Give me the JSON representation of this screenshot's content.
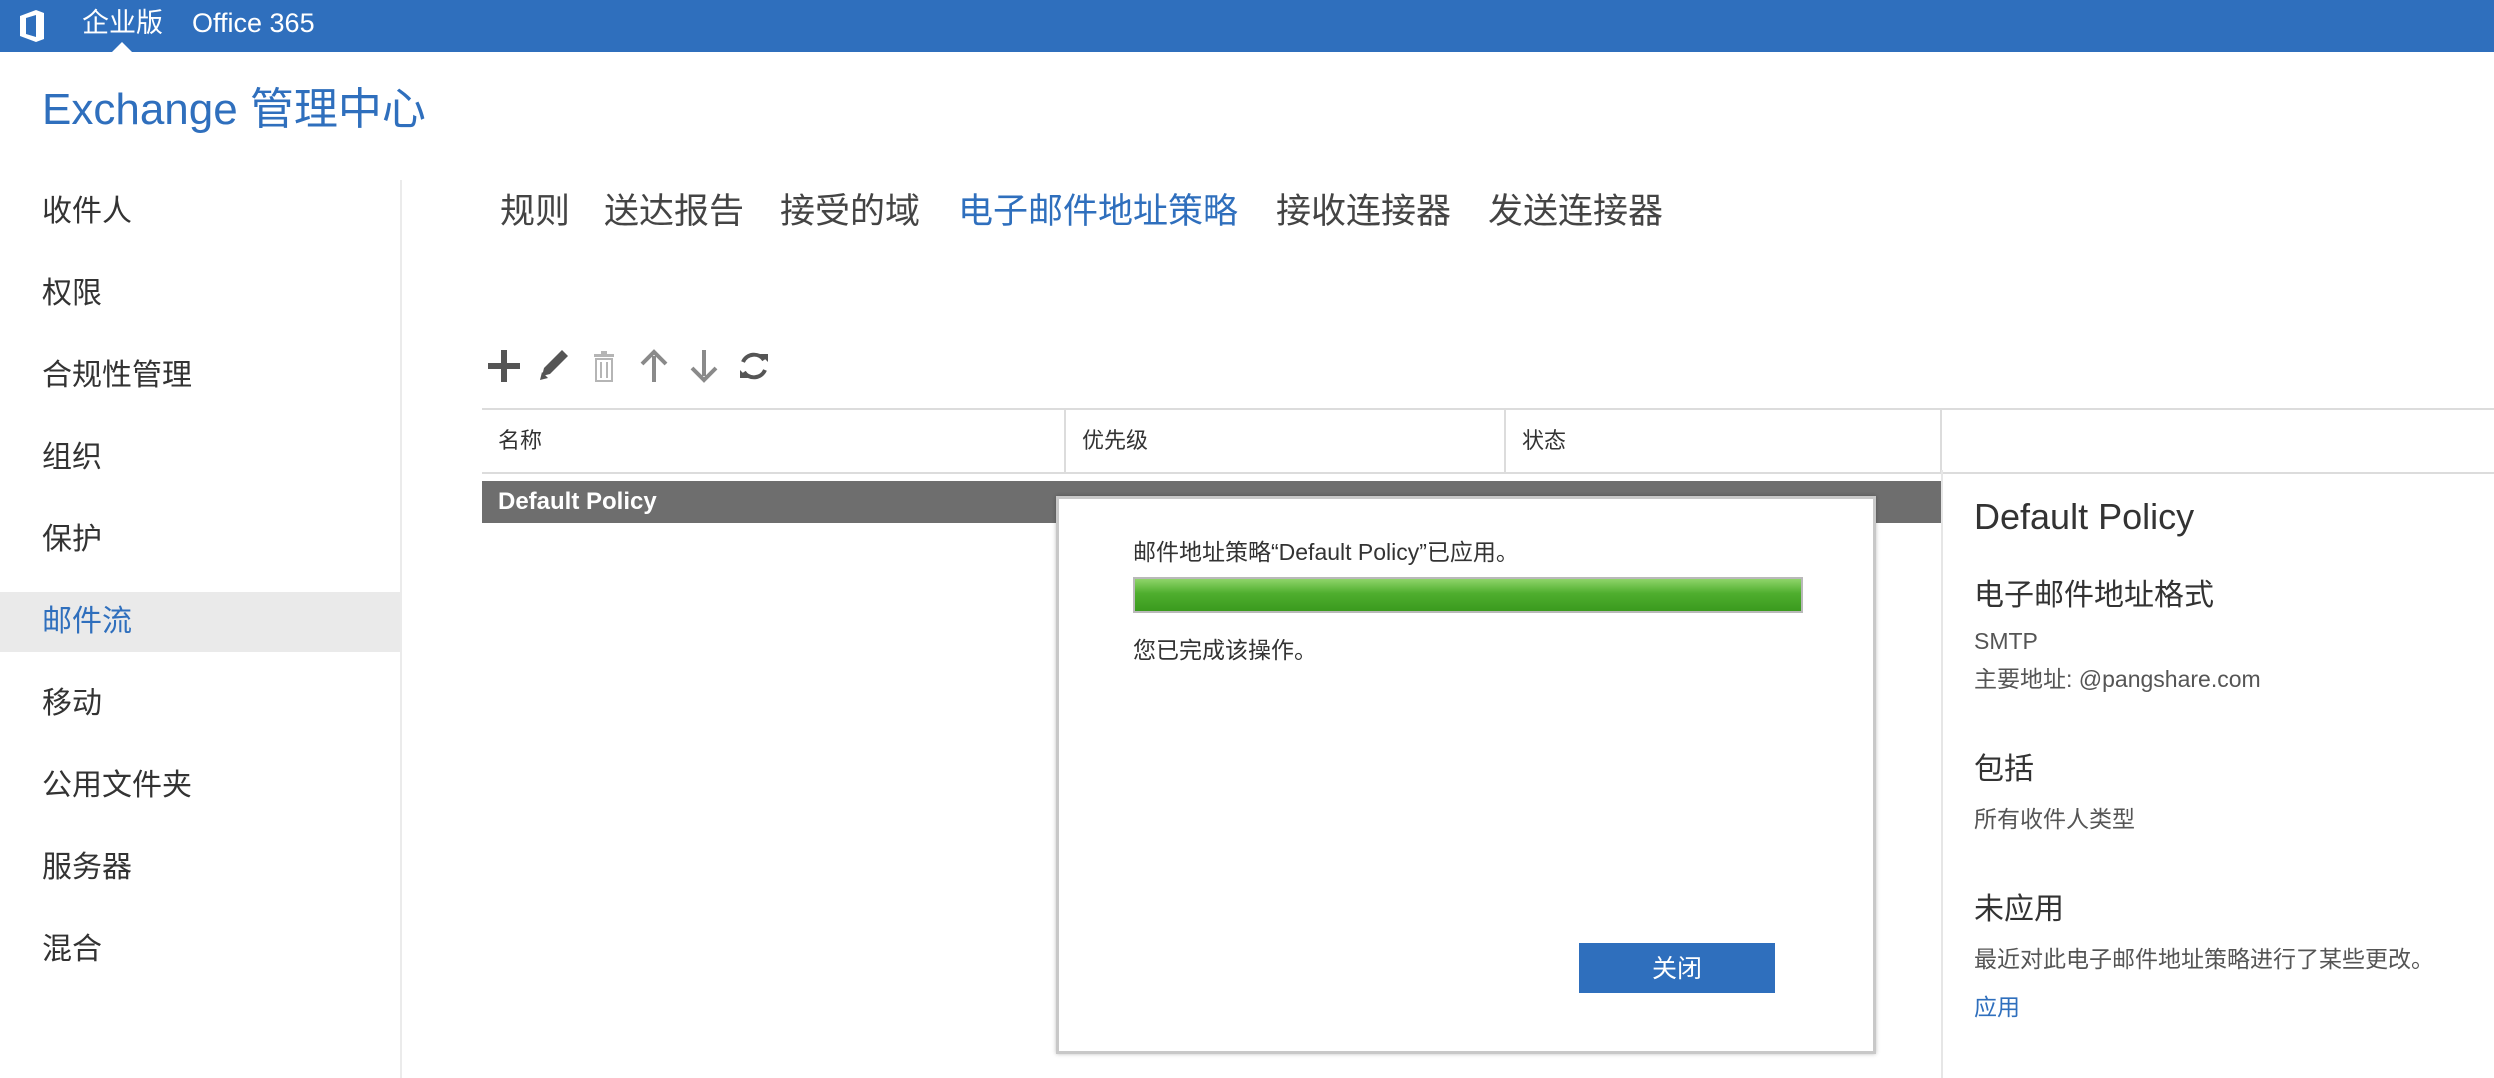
{
  "topbar": {
    "edition": "企业版",
    "product": "Office 365"
  },
  "app": {
    "title": "Exchange 管理中心"
  },
  "sidebar": {
    "items": [
      {
        "label": "收件人"
      },
      {
        "label": "权限"
      },
      {
        "label": "合规性管理"
      },
      {
        "label": "组织"
      },
      {
        "label": "保护"
      },
      {
        "label": "邮件流"
      },
      {
        "label": "移动"
      },
      {
        "label": "公用文件夹"
      },
      {
        "label": "服务器"
      },
      {
        "label": "混合"
      }
    ],
    "active": "邮件流"
  },
  "tabs": [
    {
      "label": "规则"
    },
    {
      "label": "送达报告"
    },
    {
      "label": "接受的域"
    },
    {
      "label": "电子邮件地址策略"
    },
    {
      "label": "接收连接器"
    },
    {
      "label": "发送连接器"
    }
  ],
  "toolbar": {
    "icons": [
      "add-icon",
      "edit-icon",
      "delete-icon",
      "move-up-icon",
      "move-down-icon",
      "refresh-icon"
    ]
  },
  "table": {
    "columns": [
      "名称",
      "优先级",
      "状态"
    ],
    "rows": [
      {
        "name": "Default Policy"
      }
    ]
  },
  "details": {
    "title": "Default Policy",
    "format_heading": "电子邮件地址格式",
    "format_type": "SMTP",
    "primary_address": "主要地址: @pangshare.com",
    "includes_heading": "包括",
    "includes_value": "所有收件人类型",
    "not_applied_heading": "未应用",
    "not_applied_text": "最近对此电子邮件地址策略进行了某些更改。",
    "apply_link": "应用"
  },
  "dialog": {
    "message": "邮件地址策略“Default Policy”已应用。",
    "progress": 1.0,
    "done_text": "您已完成该操作。",
    "close_label": "关闭"
  },
  "colors": {
    "accent": "#2f6fbd",
    "progress": "#4fae2e",
    "selected_row": "#6e6e6e"
  }
}
